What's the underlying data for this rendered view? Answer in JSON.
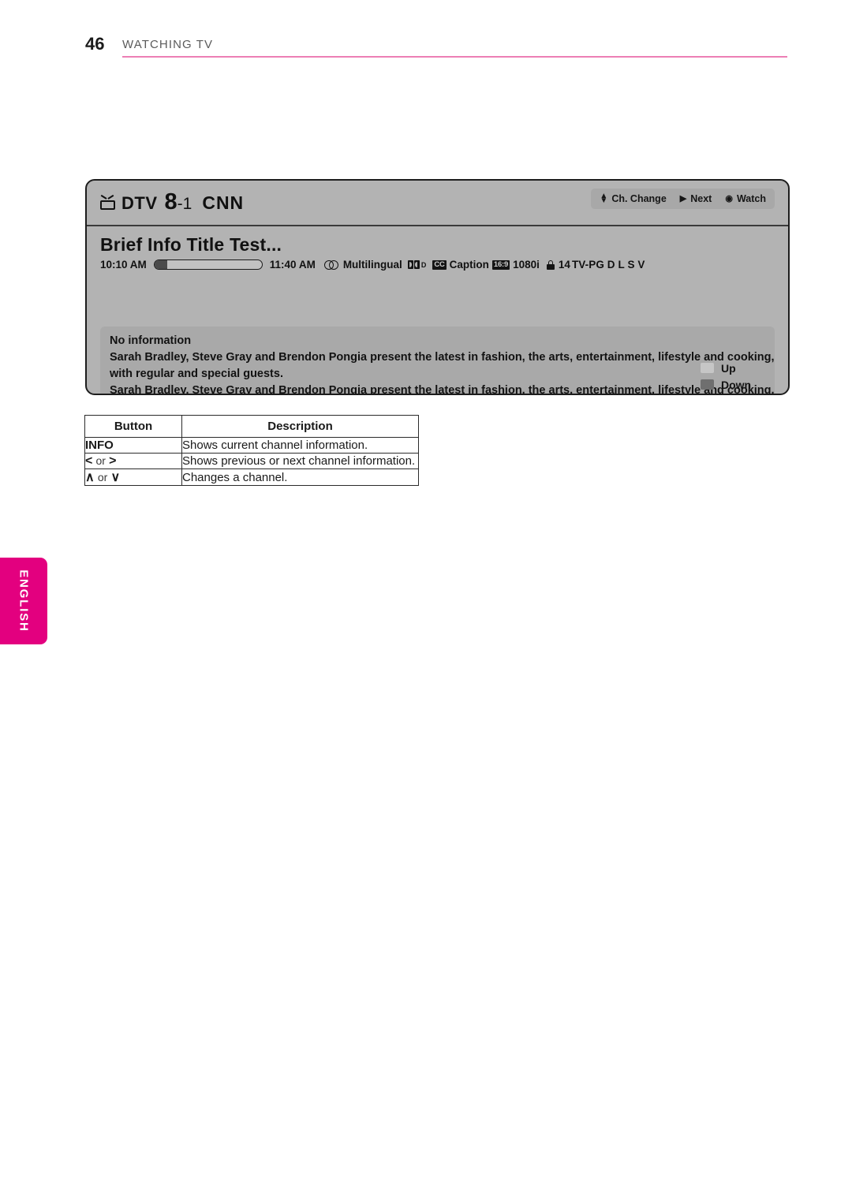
{
  "page": {
    "number": "46",
    "section": "WATCHING TV",
    "rule_color": "#ec7fb5"
  },
  "osd": {
    "channel": {
      "tv_icon": "tv-icon",
      "source": "DTV",
      "major": "8",
      "minor": "-1",
      "callsign": "CNN"
    },
    "keys": [
      {
        "glyph": "⇅",
        "label": "Ch. Change"
      },
      {
        "glyph": "▶",
        "label": "Next"
      },
      {
        "glyph": "◉",
        "label": "Watch"
      }
    ],
    "program": {
      "title": "Brief Info Title Test...",
      "start_time": "10:10 AM",
      "end_time": "11:40 AM",
      "progress_percent": 12,
      "audio_label": "Multilingual",
      "caption_cc": "CC",
      "caption_label": "Caption",
      "aspect_badge": "16:9",
      "resolution": "1080i",
      "rating_age": "14",
      "rating": "TV-PG D L S V",
      "dolby_suffix": "D"
    },
    "description": {
      "lines": [
        "No information",
        "Sarah Bradley, Steve Gray and Brendon Pongia present the latest in fashion, the arts, entertainment, lifestyle and cooking,",
        "with regular and special guests.",
        "Sarah Bradley, Steve Gray and Brendon Pongia present the latest in fashion, the arts, entertainment, lifestyle and cooking,"
      ],
      "more_arrow": "▼",
      "scroll_hints": [
        {
          "label": "Up",
          "color": "#c6c6c6"
        },
        {
          "label": "Down",
          "color": "#6f6f6f"
        }
      ]
    },
    "colors": {
      "banner_bg": "#b3b3b3",
      "panel_bg": "#a9a9a9",
      "border": "#1d1d1d"
    }
  },
  "button_table": {
    "headers": [
      "Button",
      "Description"
    ],
    "rows": [
      {
        "button_plain": "INFO",
        "description": "Shows current channel information."
      },
      {
        "button_glyph_left": "<",
        "button_or": "or",
        "button_glyph_right": ">",
        "description": "Shows previous or next channel information."
      },
      {
        "button_glyph_left": "∧",
        "button_or": "or",
        "button_glyph_right": "∨",
        "description": "Changes a channel."
      }
    ]
  },
  "language_tab": {
    "label": "ENGLISH",
    "color": "#e3007f"
  }
}
